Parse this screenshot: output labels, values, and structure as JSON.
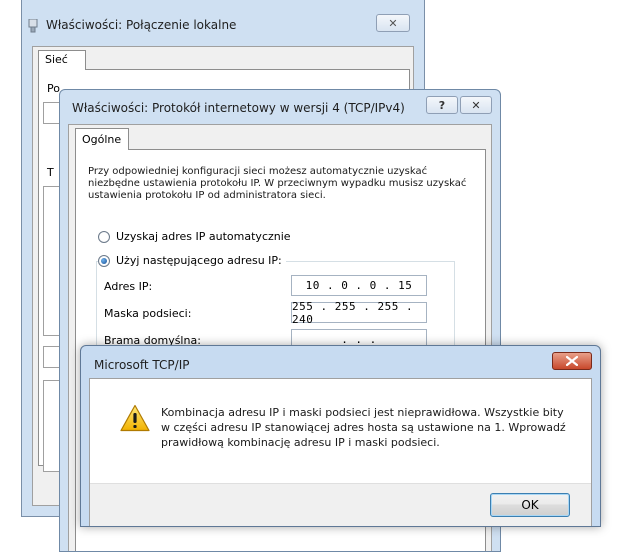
{
  "back_window": {
    "title": "Właściwości: Połączenie lokalne",
    "close_glyph": "✕",
    "tab_label": "Sieć",
    "label_partial_1": "Po",
    "label_partial_2": "T"
  },
  "ipv4_window": {
    "title": "Właściwości: Protokół internetowy w wersji 4 (TCP/IPv4)",
    "help_glyph": "?",
    "close_glyph": "✕",
    "tab_label": "Ogólne",
    "description": "Przy odpowiedniej konfiguracji sieci możesz automatycznie uzyskać niezbędne ustawienia protokołu IP. W przeciwnym wypadku musisz uzyskać ustawienia protokołu IP od administratora sieci.",
    "radio_auto_label": "Uzyskaj adres IP automatycznie",
    "radio_manual_label": "Użyj następującego adresu IP:",
    "selected_option": "manual",
    "fields": {
      "ip_label": "Adres IP:",
      "ip_value": "10 .  0  .  0  . 15",
      "mask_label": "Maska podsieci:",
      "mask_value": "255 . 255 . 255 . 240",
      "gateway_label": "Brama domyślna:",
      "gateway_value": ".    .    ."
    }
  },
  "alert": {
    "title": "Microsoft TCP/IP",
    "icon": "warning-icon",
    "message": "Kombinacja adresu IP i maski podsieci jest nieprawidłowa. Wszystkie bity w części adresu IP stanowiącej adres hosta są ustawione na 1. Wprowadź prawidłową kombinację adresu IP i maski podsieci.",
    "ok_label": "OK",
    "close_color": "#c8482b"
  }
}
